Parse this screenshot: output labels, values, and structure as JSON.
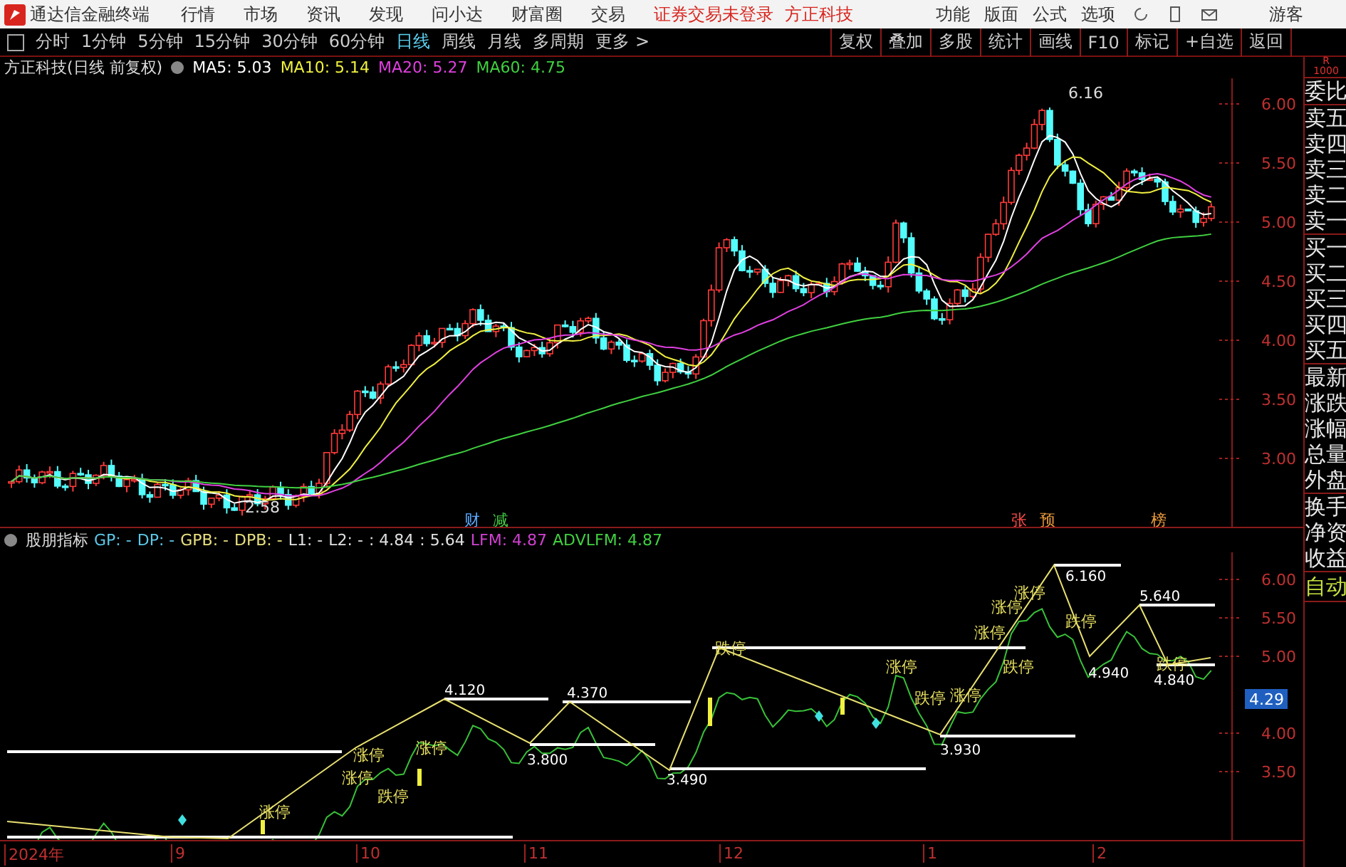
{
  "app": {
    "title": "通达信金融终端",
    "menu": [
      "行情",
      "市场",
      "资讯",
      "发现",
      "问小达",
      "财富圈",
      "交易"
    ],
    "status": [
      "证券交易未登录",
      "方正科技"
    ],
    "tools": [
      "功能",
      "版面",
      "公式",
      "选项"
    ],
    "user": "游客"
  },
  "periods": [
    {
      "label": "分时",
      "selected": false
    },
    {
      "label": "1分钟",
      "selected": false
    },
    {
      "label": "5分钟",
      "selected": false
    },
    {
      "label": "15分钟",
      "selected": false
    },
    {
      "label": "30分钟",
      "selected": false
    },
    {
      "label": "60分钟",
      "selected": false
    },
    {
      "label": "日线",
      "selected": true
    },
    {
      "label": "周线",
      "selected": false
    },
    {
      "label": "月线",
      "selected": false
    },
    {
      "label": "多周期",
      "selected": false
    },
    {
      "label": "更多 >",
      "selected": false
    }
  ],
  "actions": [
    "复权",
    "叠加",
    "多股",
    "统计",
    "画线",
    "F10",
    "标记",
    "+自选",
    "返回"
  ],
  "legend": {
    "title": "方正科技(日线 前复权)",
    "items": [
      {
        "text": "MA5: 5.03",
        "color": "#ffffff"
      },
      {
        "text": "MA10: 5.14",
        "color": "#f0f040"
      },
      {
        "text": "MA20: 5.27",
        "color": "#e040e0"
      },
      {
        "text": "MA60: 4.75",
        "color": "#40d040"
      }
    ]
  },
  "main_chart": {
    "axis": [
      "6.00",
      "5.50",
      "5.00",
      "4.50",
      "4.00",
      "3.50",
      "3.00"
    ],
    "high_label": "6.16",
    "low_label": "2.58",
    "events": [
      {
        "text": "财",
        "color": "#5aa8ff"
      },
      {
        "text": "减",
        "color": "#44cc44"
      },
      {
        "text": "张",
        "color": "#ff4a4a"
      },
      {
        "text": "预",
        "color": "#e89a3c"
      },
      {
        "text": "榜",
        "color": "#e89a3c"
      }
    ]
  },
  "indicator": {
    "title": "股朋指标",
    "items": [
      {
        "text": "GP: -",
        "color": "#5cc8e8"
      },
      {
        "text": "DP: -",
        "color": "#5cc8e8"
      },
      {
        "text": "GPB: -",
        "color": "#e8e080"
      },
      {
        "text": "DPB: -",
        "color": "#e8e080"
      },
      {
        "text": "L1: -",
        "color": "#e0e0e0"
      },
      {
        "text": "L2: -",
        "color": "#e0e0e0"
      },
      {
        "text": ": 4.84",
        "color": "#e0e0e0"
      },
      {
        "text": ": 5.64",
        "color": "#e0e0e0"
      },
      {
        "text": "LFM: 4.87",
        "color": "#d040d0"
      },
      {
        "text": "ADVLFM: 4.87",
        "color": "#40d040"
      }
    ]
  },
  "indicator_chart": {
    "axis": [
      "6.00",
      "5.50",
      "5.00",
      "4.00",
      "3.50"
    ],
    "price_badge": "4.29",
    "levels": [
      {
        "text": "4.120"
      },
      {
        "text": "3.800"
      },
      {
        "text": "4.370"
      },
      {
        "text": "3.490"
      },
      {
        "text": "3.930"
      },
      {
        "text": "6.160"
      },
      {
        "text": "4.940"
      },
      {
        "text": "5.640"
      },
      {
        "text": "4.840"
      }
    ],
    "signals": [
      {
        "text": "涨停"
      },
      {
        "text": "涨停"
      },
      {
        "text": "跌停"
      },
      {
        "text": "涨停"
      },
      {
        "text": "涨停"
      },
      {
        "text": "跌停"
      },
      {
        "text": "涨停"
      },
      {
        "text": "跌停"
      },
      {
        "text": "涨停"
      },
      {
        "text": "涨停"
      },
      {
        "text": "跌停"
      },
      {
        "text": "涨停"
      },
      {
        "text": "涨停"
      },
      {
        "text": "跌停"
      },
      {
        "text": "跌停"
      }
    ]
  },
  "dates": [
    "2024年",
    "9",
    "10",
    "11",
    "12",
    "1",
    "2"
  ],
  "side_panel": {
    "header": [
      "R",
      "1000"
    ],
    "items": [
      "委比",
      "卖五",
      "卖四",
      "卖三",
      "卖二",
      "卖一",
      "买一",
      "买二",
      "买三",
      "买四",
      "买五",
      "最新",
      "涨跌",
      "涨幅",
      "总量",
      "外盘",
      "换手",
      "净资",
      "收益"
    ],
    "mode": "自动"
  }
}
